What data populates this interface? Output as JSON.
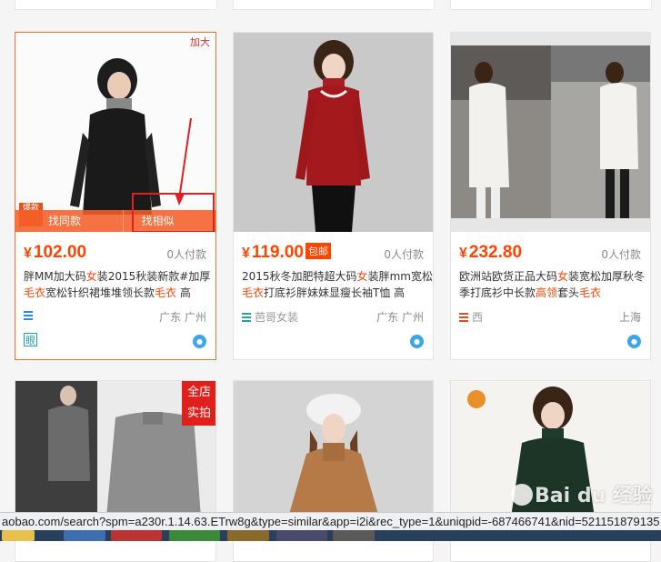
{
  "products": [
    {
      "price": "102.00",
      "paid": "0人付款",
      "title_parts": [
        {
          "t": "胖MM加大码",
          "hl": false
        },
        {
          "t": "女",
          "hl": true
        },
        {
          "t": "装2015秋装新款#加厚",
          "hl": false
        },
        {
          "t": "毛衣",
          "hl": true
        },
        {
          "t": "宽松针织裙堆堆领长款",
          "hl": false
        },
        {
          "t": "毛衣",
          "hl": true
        },
        {
          "t": " 高",
          "hl": false
        }
      ],
      "shop": "",
      "location": "广东 广州",
      "tmall_label": "眼",
      "find_same_label": "找同款",
      "find_similar_label": "找相似",
      "hot_stamp": "爆款",
      "add_tag": "加大"
    },
    {
      "price": "119.00",
      "baoyou": "包邮",
      "paid": "0人付款",
      "title_parts": [
        {
          "t": "2015秋冬加肥特超大码",
          "hl": false
        },
        {
          "t": "女",
          "hl": true
        },
        {
          "t": "装胖mm宽松",
          "hl": false
        },
        {
          "t": "毛衣",
          "hl": true
        },
        {
          "t": "打底衫胖妹妹显瘦长袖T恤 高",
          "hl": false
        }
      ],
      "shop": "芭哥女装",
      "location": "广东 广州"
    },
    {
      "price": "232.80",
      "paid": "0人付款",
      "title_parts": [
        {
          "t": "欧洲站欧货正品大码",
          "hl": false
        },
        {
          "t": "女",
          "hl": true
        },
        {
          "t": "装宽松加厚秋冬季打底衫中长款",
          "hl": false
        },
        {
          "t": "高领",
          "hl": true
        },
        {
          "t": "套头",
          "hl": false
        },
        {
          "t": "毛衣",
          "hl": true
        }
      ],
      "shop": "西",
      "location": "上海"
    }
  ],
  "row2": [
    {
      "tag": "全店实拍"
    },
    {},
    {}
  ],
  "status_url": "aobao.com/search?spm=a230r.1.14.63.ETrw8g&type=similar&app=i2i&rec_type=1&uniqpid=-687466741&nid=521151879135",
  "watermark": "Bai du 经验",
  "colors": {
    "accent": "#ff4400",
    "highlight_border": "#f4702e",
    "annotation": "#e02020"
  }
}
